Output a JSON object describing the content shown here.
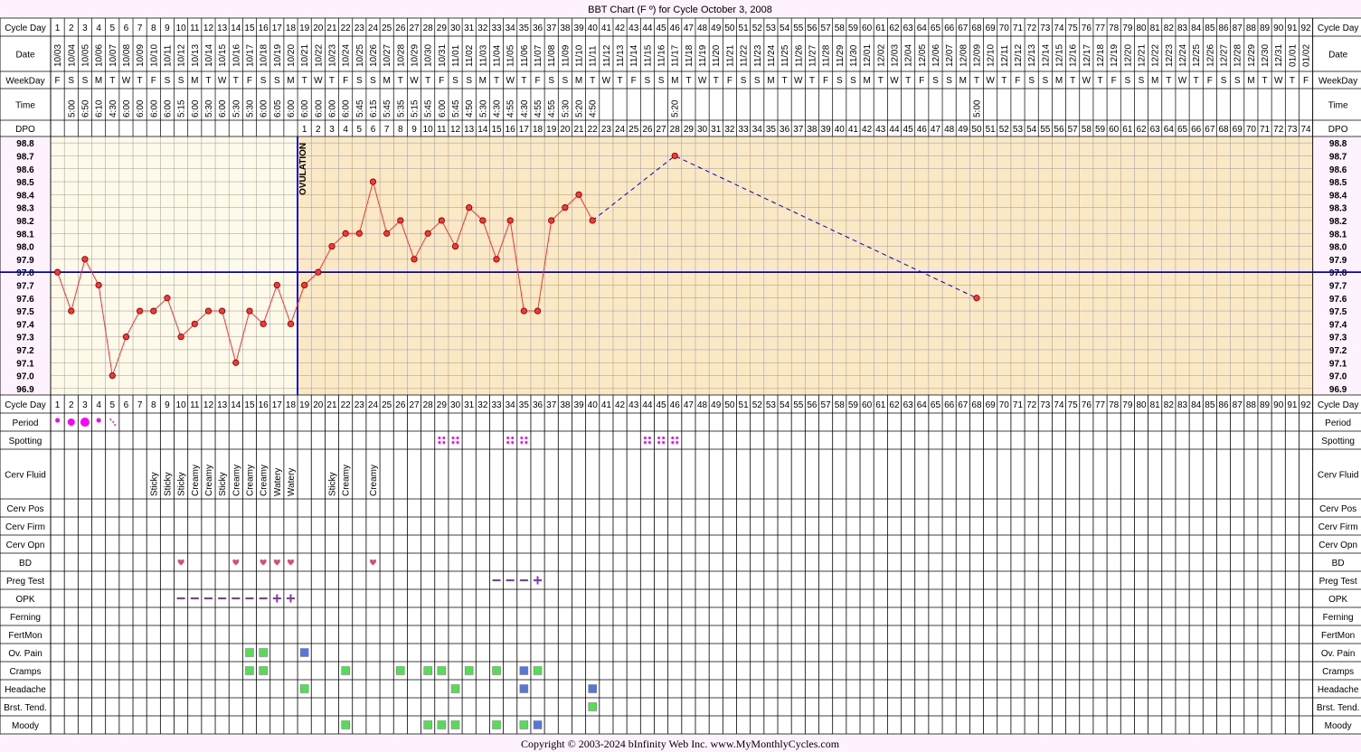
{
  "title": "BBT Chart (F º) for Cycle October 3, 2008",
  "footer": "Copyright © 2003-2024 bInfinity Web Inc.     www.MyMonthlyCycles.com",
  "colors": {
    "background": "#fdf2fd",
    "pre_ovulation_fill": "#fdfae9",
    "post_ovulation_fill": "#fbe8c5",
    "temp_line": "#ff3333",
    "coverline": "#0000cc",
    "ovulation_line": "#0000cc",
    "period": "#ff00ff",
    "heart": "#e0457b",
    "test_mark": "#8833bb",
    "green_box": "#55dd55",
    "blue_box": "#5577dd"
  },
  "labels": {
    "cycle_day": "Cycle Day",
    "date": "Date",
    "weekday": "WeekDay",
    "time": "Time",
    "dpo": "DPO",
    "ovulation": "OVULATION"
  },
  "rows": [
    "Period",
    "Spotting",
    "Cerv Fluid",
    "Cerv Pos",
    "Cerv Firm",
    "Cerv Opn",
    "BD",
    "Preg Test",
    "OPK",
    "Ferning",
    "FertMon",
    "Ov. Pain",
    "Cramps",
    "Headache",
    "Brst. Tend.",
    "Moody"
  ],
  "dates": [
    "10/03",
    "10/04",
    "10/05",
    "10/06",
    "10/07",
    "10/08",
    "10/09",
    "10/10",
    "10/11",
    "10/12",
    "10/13",
    "10/14",
    "10/15",
    "10/16",
    "10/17",
    "10/18",
    "10/19",
    "10/20",
    "10/21",
    "10/22",
    "10/23",
    "10/24",
    "10/25",
    "10/26",
    "10/27",
    "10/28",
    "10/29",
    "10/30",
    "10/31",
    "11/01",
    "11/02",
    "11/03",
    "11/04",
    "11/05",
    "11/06",
    "11/07",
    "11/08",
    "11/09",
    "11/10",
    "11/11",
    "11/12",
    "11/13",
    "11/14",
    "11/15",
    "11/16",
    "11/17",
    "11/18",
    "11/19",
    "11/20",
    "11/21",
    "11/22",
    "11/23",
    "11/24",
    "11/25",
    "11/26",
    "11/27",
    "11/28",
    "11/29",
    "11/30",
    "12/01",
    "12/02",
    "12/03",
    "12/04",
    "12/05",
    "12/06",
    "12/07",
    "12/08",
    "12/09",
    "12/10",
    "12/11",
    "12/12",
    "12/13",
    "12/14",
    "12/15",
    "12/16",
    "12/17",
    "12/18",
    "12/19",
    "12/20",
    "12/21",
    "12/22",
    "12/23",
    "12/24",
    "12/25",
    "12/26",
    "12/27",
    "12/28",
    "12/29",
    "12/30",
    "12/31",
    "01/01",
    "01/02"
  ],
  "weekdays": [
    "F",
    "S",
    "S",
    "M",
    "T",
    "W",
    "T",
    "F",
    "S",
    "S",
    "M",
    "T",
    "W",
    "T",
    "F",
    "S",
    "S",
    "M",
    "T",
    "W",
    "T",
    "F",
    "S",
    "S",
    "M",
    "T",
    "W",
    "T",
    "F",
    "S",
    "S",
    "M",
    "T",
    "W",
    "T",
    "F",
    "S",
    "S",
    "M",
    "T",
    "W",
    "T",
    "F",
    "S",
    "S",
    "M",
    "T",
    "W",
    "T",
    "F",
    "S",
    "S",
    "M",
    "T",
    "W",
    "T",
    "F",
    "S",
    "S",
    "M",
    "T",
    "W",
    "T",
    "F",
    "S",
    "S",
    "M",
    "T",
    "W",
    "T",
    "F",
    "S",
    "S",
    "M",
    "T",
    "W",
    "T",
    "F",
    "S",
    "S",
    "M",
    "T",
    "W",
    "T",
    "F",
    "S",
    "S",
    "M",
    "T",
    "W",
    "T",
    "F"
  ],
  "times": {
    "2": "5:00",
    "3": "6:50",
    "4": "6:10",
    "5": "4:30",
    "6": "6:00",
    "7": "6:00",
    "8": "6:00",
    "9": "6:00",
    "10": "5:15",
    "11": "6:00",
    "12": "5:30",
    "13": "6:00",
    "14": "5:30",
    "15": "5:30",
    "16": "6:00",
    "17": "6:05",
    "18": "6:00",
    "19": "6:00",
    "20": "6:00",
    "21": "6:00",
    "22": "6:00",
    "23": "5:45",
    "24": "6:15",
    "25": "5:45",
    "26": "5:35",
    "27": "5:15",
    "28": "5:45",
    "29": "6:00",
    "30": "5:45",
    "31": "4:50",
    "32": "5:30",
    "33": "4:30",
    "34": "4:55",
    "35": "4:30",
    "36": "4:55",
    "37": "4:55",
    "38": "5:30",
    "39": "5:20",
    "40": "4:50",
    "46": "5:20",
    "68": "5:00"
  },
  "cerv_fluid": {
    "8": "Sticky",
    "9": "Sticky",
    "10": "Sticky",
    "11": "Creamy",
    "12": "Creamy",
    "13": "Sticky",
    "14": "Creamy",
    "15": "Creamy",
    "16": "Creamy",
    "17": "Watery",
    "18": "Watery",
    "21": "Sticky",
    "22": "Creamy",
    "24": "Creamy"
  },
  "period": {
    "1": "small",
    "2": "medium",
    "3": "large",
    "4": "small",
    "5": "spotty"
  },
  "spotting_days": [
    29,
    30,
    34,
    35,
    44,
    45,
    46
  ],
  "bd_days": [
    10,
    14,
    16,
    17,
    18,
    24
  ],
  "preg_test": {
    "33": "-",
    "34": "-",
    "35": "-",
    "36": "+"
  },
  "opk": {
    "10": "-",
    "11": "-",
    "12": "-",
    "13": "-",
    "14": "-",
    "15": "-",
    "16": "-",
    "17": "+",
    "18": "+"
  },
  "symptoms": {
    "Ov. Pain": {
      "15": "green",
      "16": "green",
      "19": "blue"
    },
    "Cramps": {
      "15": "green",
      "16": "green",
      "22": "green",
      "26": "green",
      "28": "green",
      "29": "green",
      "31": "green",
      "33": "green",
      "35": "blue",
      "36": "green"
    },
    "Headache": {
      "19": "green",
      "30": "green",
      "35": "blue",
      "40": "blue"
    },
    "Brst. Tend.": {
      "40": "green"
    },
    "Moody": {
      "22": "green",
      "28": "green",
      "29": "green",
      "30": "green",
      "33": "green",
      "35": "green",
      "36": "blue"
    }
  },
  "chart_data": {
    "type": "line",
    "title": "BBT Chart (F º) for Cycle October 3, 2008",
    "x_label": "Cycle Day",
    "y_label": "",
    "x_range": [
      1,
      92
    ],
    "y_range": [
      96.9,
      98.8
    ],
    "y_ticks": [
      "96.9",
      "97.0",
      "97.1",
      "97.2",
      "97.3",
      "97.4",
      "97.5",
      "97.6",
      "97.7",
      "97.8",
      "97.9",
      "98.0",
      "98.1",
      "98.2",
      "98.3",
      "98.4",
      "98.5",
      "98.6",
      "98.7",
      "98.8"
    ],
    "grid": true,
    "coverline": 97.8,
    "ovulation_day": 18,
    "dpo_start_day": 19,
    "dpo_numbers": [
      "1",
      "2",
      "3",
      "4",
      "5",
      "6",
      "7",
      "8",
      "9",
      "10",
      "11",
      "12",
      "13",
      "14",
      "15",
      "16",
      "17",
      "18",
      "19",
      "20",
      "21",
      "22",
      "23",
      "24",
      "25",
      "26",
      "27",
      "28",
      "29",
      "30",
      "31",
      "32",
      "33",
      "34",
      "35",
      "36",
      "37",
      "38",
      "39",
      "40",
      "41",
      "42",
      "43",
      "44",
      "45",
      "46",
      "47",
      "48",
      "49",
      "50",
      "51",
      "52",
      "53",
      "54",
      "55",
      "56",
      "57",
      "58",
      "59",
      "60",
      "61",
      "62",
      "63",
      "64",
      "65",
      "66",
      "67",
      "68",
      "69",
      "70",
      "71",
      "72",
      "73",
      "74"
    ],
    "series": [
      {
        "style": "solid",
        "points": [
          [
            1,
            97.8
          ],
          [
            2,
            97.5
          ],
          [
            3,
            97.9
          ],
          [
            4,
            97.7
          ],
          [
            5,
            97.0
          ],
          [
            6,
            97.3
          ],
          [
            7,
            97.5
          ],
          [
            8,
            97.5
          ],
          [
            9,
            97.6
          ],
          [
            10,
            97.3
          ],
          [
            11,
            97.4
          ],
          [
            12,
            97.5
          ],
          [
            13,
            97.5
          ],
          [
            14,
            97.1
          ],
          [
            15,
            97.5
          ],
          [
            16,
            97.4
          ],
          [
            17,
            97.7
          ],
          [
            18,
            97.4
          ],
          [
            19,
            97.7
          ],
          [
            20,
            97.8
          ],
          [
            21,
            98.0
          ],
          [
            22,
            98.1
          ],
          [
            23,
            98.1
          ],
          [
            24,
            98.5
          ],
          [
            25,
            98.1
          ],
          [
            26,
            98.2
          ],
          [
            27,
            97.9
          ],
          [
            28,
            98.1
          ],
          [
            29,
            98.2
          ],
          [
            30,
            98.0
          ],
          [
            31,
            98.3
          ],
          [
            32,
            98.2
          ],
          [
            33,
            97.9
          ],
          [
            34,
            98.2
          ],
          [
            35,
            97.5
          ],
          [
            36,
            97.5
          ],
          [
            37,
            98.2
          ],
          [
            38,
            98.3
          ],
          [
            39,
            98.4
          ],
          [
            40,
            98.2
          ]
        ]
      },
      {
        "style": "dashed",
        "points": [
          [
            40,
            98.2
          ],
          [
            46,
            98.7
          ],
          [
            68,
            97.6
          ]
        ]
      }
    ]
  }
}
